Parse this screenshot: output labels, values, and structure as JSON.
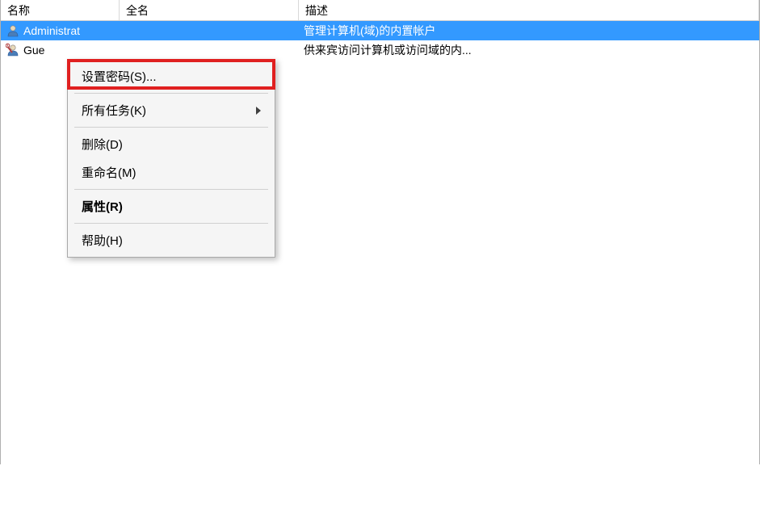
{
  "columns": {
    "name": "名称",
    "fullname": "全名",
    "description": "描述"
  },
  "users": [
    {
      "name": "Administrat",
      "fullname": "",
      "description": "管理计算机(域)的内置帐户",
      "selected": true
    },
    {
      "name": "Gue",
      "fullname": "",
      "description": "供来宾访问计算机或访问域的内...",
      "selected": false
    }
  ],
  "menu": {
    "setPassword": "设置密码(S)...",
    "allTasks": "所有任务(K)",
    "delete": "删除(D)",
    "rename": "重命名(M)",
    "properties": "属性(R)",
    "help": "帮助(H)"
  }
}
